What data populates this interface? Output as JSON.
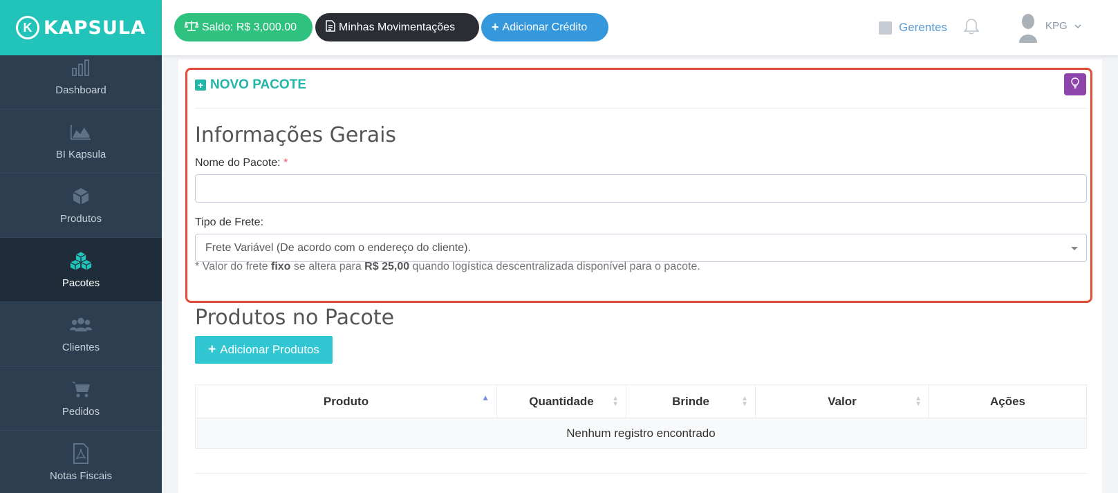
{
  "brand": {
    "name": "KAPSULA",
    "accent": "#22c3b9"
  },
  "sidebar": {
    "items": [
      {
        "label": "Dashboard",
        "icon": "bar-chart-icon"
      },
      {
        "label": "BI Kapsula",
        "icon": "area-chart-icon"
      },
      {
        "label": "Produtos",
        "icon": "cube-icon"
      },
      {
        "label": "Pacotes",
        "icon": "cubes-icon",
        "active": true
      },
      {
        "label": "Clientes",
        "icon": "users-icon"
      },
      {
        "label": "Pedidos",
        "icon": "cart-icon"
      },
      {
        "label": "Notas Fiscais",
        "icon": "pdf-file-icon"
      }
    ]
  },
  "topbar": {
    "saldo": "Saldo: R$ 3,000.00",
    "movimentacoes": "Minhas Movimentações",
    "adicionar_credito": "Adicionar Crédito",
    "gerentes": "Gerentes",
    "user": "KPG"
  },
  "card": {
    "title": "NOVO PACOTE",
    "section_general": "Informações Gerais",
    "nome_label": "Nome do Pacote:",
    "required_mark": "*",
    "nome_value": "",
    "frete_label": "Tipo de Frete:",
    "frete_selected": "Frete Variável (De acordo com o endereço do cliente).",
    "note_prefix": "* Valor do frete ",
    "note_bold1": "fixo",
    "note_mid": " se altera para ",
    "note_bold2": "R$ 25,00",
    "note_suffix": " quando logística descentralizada disponível para o pacote.",
    "section_products": "Produtos no Pacote",
    "add_products": "Adicionar Produtos"
  },
  "table": {
    "columns": [
      "Produto",
      "Quantidade",
      "Brinde",
      "Valor",
      "Ações"
    ],
    "empty": "Nenhum registro encontrado"
  },
  "colors": {
    "sidebar_bg": "#2c3e50",
    "saldo_green": "#2ec27e",
    "movimentacoes_dark": "#2a2d34",
    "credito_blue": "#3598dc",
    "title_teal": "#22b5a8",
    "highlight_red": "#e04b35",
    "bulb_purple": "#8e44ad",
    "add_button_cyan": "#32c5d2"
  }
}
